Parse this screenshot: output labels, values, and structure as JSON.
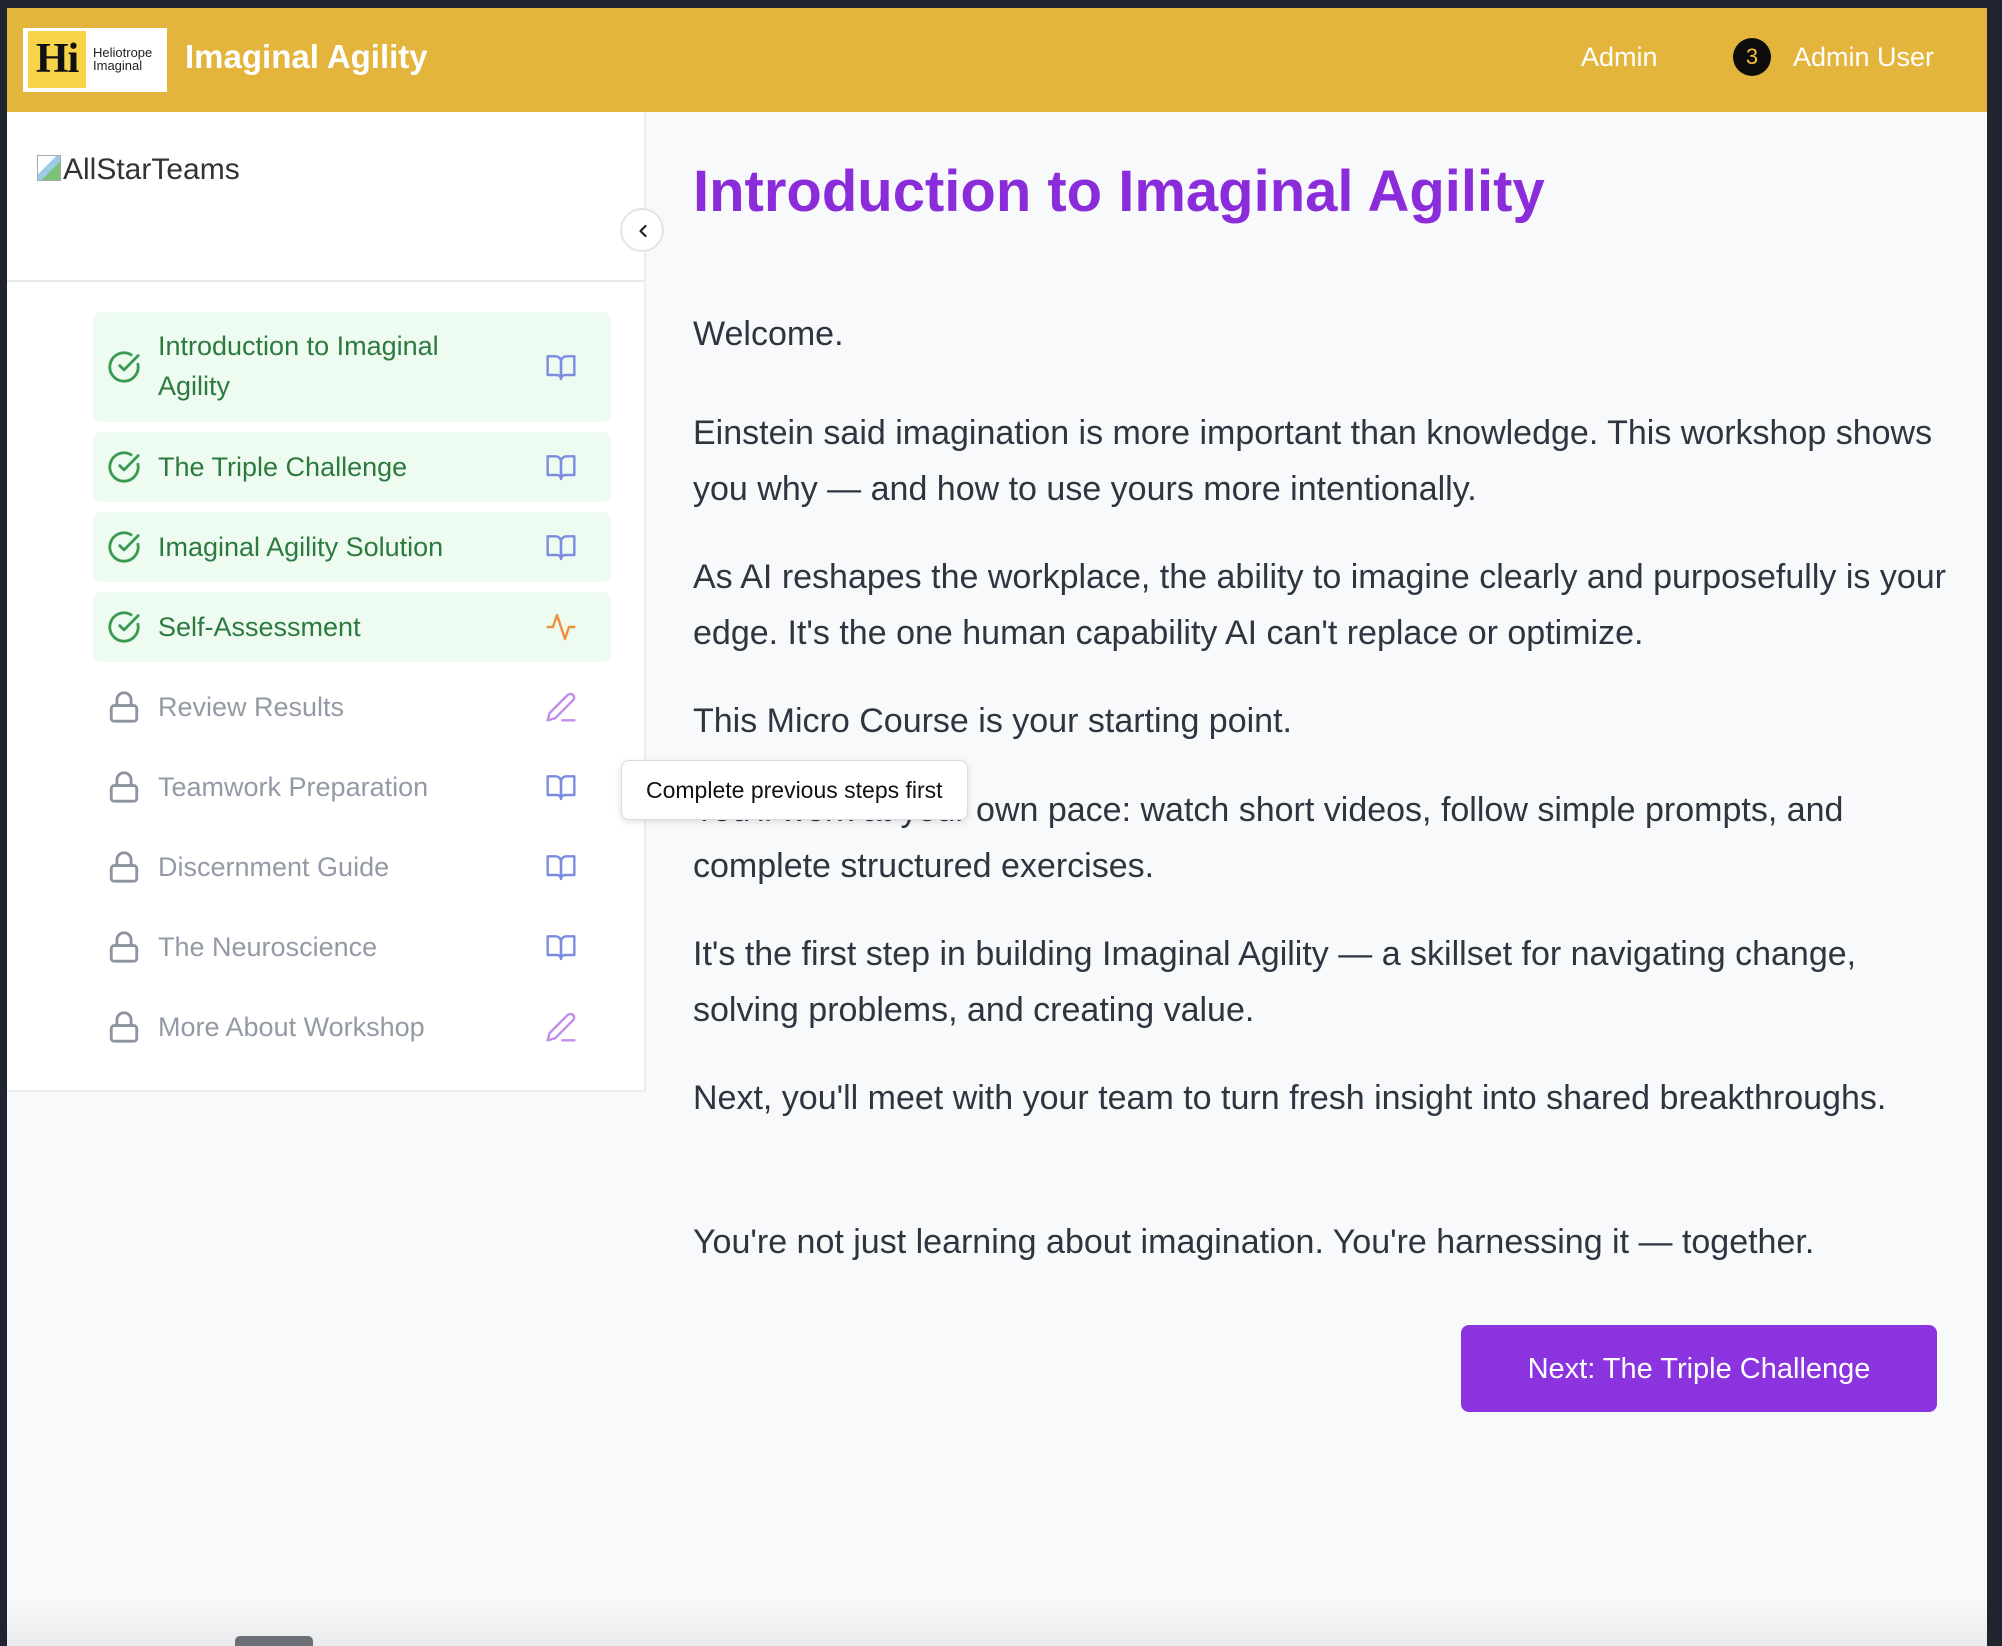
{
  "header": {
    "logo_mark": "Hi",
    "logo_text": "Heliotrope\nImaginal",
    "app_title": "Imaginal Agility",
    "admin_link": "Admin",
    "notification_count": "3",
    "user_name": "Admin User",
    "bg_color": "#e3b53c"
  },
  "sidebar": {
    "brand_alt": "AllStarTeams",
    "collapse_icon": "chevron-left-icon",
    "items": [
      {
        "label_line1": "Introduction to Imaginal",
        "label_line2": "Agility",
        "status": "completed",
        "lead_icon": "check-circle-icon",
        "trail_icon": "book-open-icon"
      },
      {
        "label": "The Triple Challenge",
        "status": "completed",
        "lead_icon": "check-circle-icon",
        "trail_icon": "book-open-icon"
      },
      {
        "label": "Imaginal Agility Solution",
        "status": "completed",
        "lead_icon": "check-circle-icon",
        "trail_icon": "book-open-icon"
      },
      {
        "label": "Self-Assessment",
        "status": "completed",
        "lead_icon": "check-circle-icon",
        "trail_icon": "activity-icon"
      },
      {
        "label": "Review Results",
        "status": "locked",
        "lead_icon": "lock-icon",
        "trail_icon": "pencil-icon"
      },
      {
        "label": "Teamwork Preparation",
        "status": "locked",
        "lead_icon": "lock-icon",
        "trail_icon": "book-open-icon"
      },
      {
        "label": "Discernment Guide",
        "status": "locked",
        "lead_icon": "lock-icon",
        "trail_icon": "book-open-icon"
      },
      {
        "label": "The Neuroscience",
        "status": "locked",
        "lead_icon": "lock-icon",
        "trail_icon": "book-open-icon"
      },
      {
        "label": "More About Workshop",
        "status": "locked",
        "lead_icon": "lock-icon",
        "trail_icon": "pencil-icon"
      }
    ]
  },
  "tooltip": "Complete previous steps first",
  "main": {
    "title": "Introduction to Imaginal Agility",
    "title_color": "#8a2cd9",
    "paragraphs": [
      "Welcome.",
      "Einstein said imagination is more important than knowledge. This workshop shows you why — and how to use yours more intentionally.",
      "As AI reshapes the workplace, the ability to imagine clearly and purposefully is your edge. It's the one human capability AI can't replace or optimize.",
      "This Micro Course is your starting point.",
      "You'll work at your own pace: watch short videos, follow simple prompts, and complete structured exercises.",
      "It's the first step in building Imaginal Agility — a skillset for navigating change, solving problems, and creating value.",
      "Next, you'll meet with your team to turn fresh insight into shared breakthroughs.",
      "You're not just learning about imagination. You're harnessing it — together."
    ],
    "next_button": "Next: The Triple Challenge",
    "button_color": "#8a33df"
  }
}
